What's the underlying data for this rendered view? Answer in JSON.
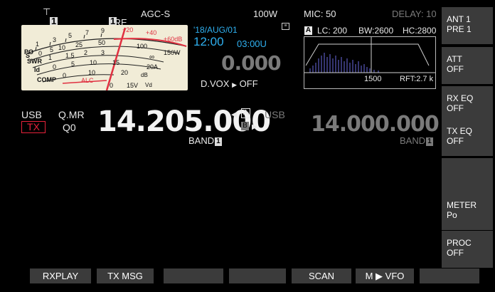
{
  "status": {
    "antenna_icon": "antenna-icon",
    "antenna_num": "1",
    "pre_label": "PRE",
    "pre_num": "1",
    "agc": "AGC-S",
    "power": "100W",
    "mic": "MIC:  50",
    "delay": "DELAY: 10"
  },
  "meter": {
    "scale_s": [
      "S",
      "1",
      "3",
      "5",
      "7",
      "9",
      "+20",
      "+40",
      "+60dB"
    ],
    "scale_po": [
      "PO",
      "0",
      "5",
      "10",
      "25",
      "50",
      "100",
      "150W"
    ],
    "scale_swr": [
      "SWR",
      "1",
      "1.5",
      "2",
      "3",
      "∞"
    ],
    "scale_id": [
      "Id",
      "0",
      "5",
      "10",
      "15",
      "20A"
    ],
    "scale_comp": [
      "COMP",
      "0",
      "10",
      "20",
      "dB",
      "0",
      "15V",
      "Vd"
    ],
    "alc_label": "ALC"
  },
  "clock": {
    "date": "'18/AUG/01",
    "time": "12:00",
    "utc": "03:00U"
  },
  "rit": "0.000",
  "dvox": {
    "label": "D.VOX",
    "arrow": "▶",
    "value": "OFF"
  },
  "scope": {
    "badge": "A",
    "lc": "LC: 200",
    "bw": "BW:2600",
    "hc": "HC:2800",
    "freq_label": "1500",
    "rft": "RFT:2.7 k"
  },
  "vfo_a": {
    "mode": "USB",
    "tx": "TX",
    "qmr": "Q.MR",
    "q0": "Q0",
    "freq": "14.205.000",
    "band_label": "BAND",
    "band_num": "1",
    "ab_a": "A",
    "ab_b": "B"
  },
  "vfo_b": {
    "mode": "USB",
    "freq": "14.000.000",
    "band_label": "BAND",
    "band_num": "1"
  },
  "softkeys": [
    {
      "l1": "ANT 1",
      "l2": "PRE 1"
    },
    {
      "l1": "ATT",
      "l2": "OFF"
    },
    {
      "l1": "RX EQ",
      "l2": "OFF"
    },
    {
      "l1": "TX EQ",
      "l2": "OFF"
    },
    {
      "l1": "",
      "l2": ""
    },
    {
      "l1": "METER",
      "l2": "Po"
    },
    {
      "l1": "PROC",
      "l2": "OFF"
    }
  ],
  "bottom_keys": [
    "RXPLAY",
    "TX MSG",
    "",
    "",
    "SCAN",
    "M ▶ VFO",
    ""
  ],
  "colors": {
    "accent_blue": "#2fb0f0",
    "tx_red": "#e8223a",
    "needle_red": "#e03040",
    "dim_grey": "#7a7a7a"
  }
}
